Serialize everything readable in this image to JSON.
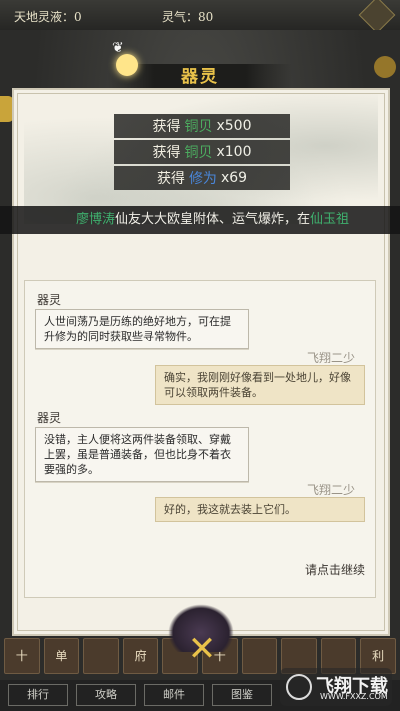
{
  "topbar": {
    "tiandi_label": "天地灵液：",
    "tiandi_value": "0",
    "lingqi_label": "灵气：",
    "lingqi_value": "80"
  },
  "panel": {
    "title": "器灵"
  },
  "rewards": [
    {
      "label": "获得",
      "item": "铜贝",
      "amount": "x500",
      "color": "green"
    },
    {
      "label": "获得",
      "item": "铜贝",
      "amount": "x100",
      "color": "green"
    },
    {
      "label": "获得",
      "item": "修为",
      "amount": "x69",
      "color": "blue"
    }
  ],
  "marquee": {
    "player": "廖博涛",
    "text": "仙友大大欧皇附体、运气爆炸，在",
    "place": "仙玉祖"
  },
  "dialog": {
    "lines": [
      {
        "speaker": "器灵",
        "text": "人世间荡乃是历练的绝好地方，可在提升修为的同时获取些寻常物件。"
      },
      {
        "speaker": "飞翔二少",
        "text": "确实，我刚刚好像看到一处地儿，好像可以领取两件装备。"
      },
      {
        "speaker": "器灵",
        "text": "没错，主人便将这两件装备领取、穿戴上罢，虽是普通装备，但也比身不着衣要强的多。"
      },
      {
        "speaker": "飞翔二少",
        "text": "好的，我这就去装上它们。"
      }
    ],
    "continue": "请点击继续"
  },
  "bottom": {
    "slots": [
      "十",
      "单",
      "",
      "府",
      "",
      "十",
      "",
      "",
      "",
      "利"
    ],
    "close": "✕",
    "nav": [
      "排行",
      "攻略",
      "邮件",
      "图鉴"
    ]
  },
  "watermark": {
    "brand": "飞翔下载",
    "url": "WWW.FXXZ.COM"
  },
  "colors": {
    "accent_gold": "#e9c24a",
    "reward_green": "#4caa5f",
    "reward_blue": "#4a86d8",
    "player_green": "#3fb06e"
  }
}
